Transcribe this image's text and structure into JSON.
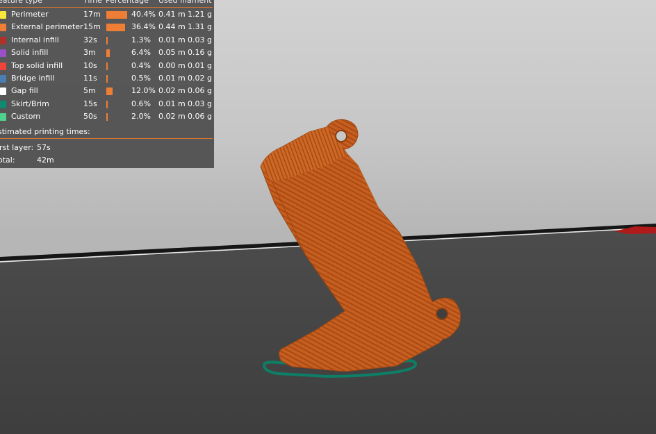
{
  "legend": {
    "headers": {
      "feature_type": "eature type",
      "time": "Time",
      "percentage": "Percentage",
      "used_filament": "Used filament"
    },
    "rows": [
      {
        "name": "Perimeter",
        "color": "#f7e63c",
        "time": "17m",
        "percent": "40.4%",
        "fraction": 0.404,
        "used_m": "0.41 m",
        "used_g": "1.21 g"
      },
      {
        "name": "External perimeter",
        "color": "#ee7d35",
        "time": "15m",
        "percent": "36.4%",
        "fraction": 0.364,
        "used_m": "0.44 m",
        "used_g": "1.31 g"
      },
      {
        "name": "Internal infill",
        "color": "#b03129",
        "time": "32s",
        "percent": "1.3%",
        "fraction": 0.013,
        "used_m": "0.01 m",
        "used_g": "0.03 g"
      },
      {
        "name": "Solid infill",
        "color": "#9a50c9",
        "time": "3m",
        "percent": "6.4%",
        "fraction": 0.064,
        "used_m": "0.05 m",
        "used_g": "0.16 g"
      },
      {
        "name": "Top solid infill",
        "color": "#f0443a",
        "time": "10s",
        "percent": "0.4%",
        "fraction": 0.004,
        "used_m": "0.00 m",
        "used_g": "0.01 g"
      },
      {
        "name": "Bridge infill",
        "color": "#4a7fb3",
        "time": "11s",
        "percent": "0.5%",
        "fraction": 0.005,
        "used_m": "0.01 m",
        "used_g": "0.02 g"
      },
      {
        "name": "Gap fill",
        "color": "#ffffff",
        "time": "5m",
        "percent": "12.0%",
        "fraction": 0.12,
        "used_m": "0.02 m",
        "used_g": "0.06 g"
      },
      {
        "name": "Skirt/Brim",
        "color": "#0e8a70",
        "time": "15s",
        "percent": "0.6%",
        "fraction": 0.006,
        "used_m": "0.01 m",
        "used_g": "0.03 g"
      },
      {
        "name": "Custom",
        "color": "#4fd28e",
        "time": "50s",
        "percent": "2.0%",
        "fraction": 0.02,
        "used_m": "0.02 m",
        "used_g": "0.06 g"
      }
    ],
    "estimated_title": "stimated printing times:",
    "first_layer_label": "irst layer:",
    "first_layer_value": "57s",
    "total_label": "otal:",
    "total_value": "42m"
  },
  "colors": {
    "accent": "#e0742c",
    "model": "#c25a1c",
    "bed": "#484848",
    "skirt": "#0e8a70",
    "axis_x": "#c81e1e"
  },
  "scene": {
    "model": "printed part preview",
    "skirt": "skirt outline",
    "axis": "x-axis arrow"
  }
}
